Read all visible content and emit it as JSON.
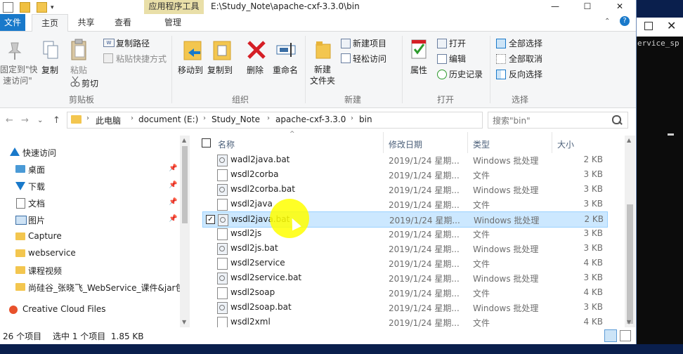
{
  "console": {
    "text": "ervice_sp",
    "close_glyph": "✕",
    "max_glyph": ""
  },
  "titlebar": {
    "context_tab": "应用程序工具",
    "path": "E:\\Study_Note\\apache-cxf-3.3.0\\bin",
    "qa_dropdown": "▾",
    "minimize": "—",
    "maximize": "☐",
    "close": "✕"
  },
  "tabs": {
    "file": "文件",
    "home": "主页",
    "share": "共享",
    "view": "查看",
    "manage": "管理",
    "collapse": "⌃",
    "help": "?"
  },
  "ribbon": {
    "clipboard": {
      "pin_quick": "固定到\"快\n速访问\"",
      "copy": "复制",
      "paste": "粘贴",
      "copy_path": "复制路径",
      "paste_shortcut": "粘贴快捷方式",
      "cut": "剪切",
      "label": "剪贴板"
    },
    "organize": {
      "move_to": "移动到",
      "copy_to": "复制到",
      "delete": "删除",
      "rename": "重命名",
      "label": "组织"
    },
    "new": {
      "new_folder": "新建\n文件夹",
      "new_item": "新建项目",
      "easy_access": "轻松访问",
      "label": "新建"
    },
    "open": {
      "properties": "属性",
      "open": "打开",
      "edit": "编辑",
      "history": "历史记录",
      "label": "打开"
    },
    "select": {
      "select_all": "全部选择",
      "select_none": "全部取消",
      "invert": "反向选择",
      "label": "选择"
    }
  },
  "nav": {
    "back": "←",
    "forward": "→",
    "recent": "⌄",
    "up": "↑",
    "breadcrumb": [
      "此电脑",
      "document (E:)",
      "Study_Note",
      "apache-cxf-3.3.0",
      "bin"
    ],
    "sep": "›",
    "search_placeholder": "搜索\"bin\""
  },
  "navpane": {
    "quick_access": "快速访问",
    "items": [
      {
        "label": "桌面",
        "pinned": true
      },
      {
        "label": "下载",
        "pinned": true
      },
      {
        "label": "文档",
        "pinned": true
      },
      {
        "label": "图片",
        "pinned": true
      },
      {
        "label": "Capture",
        "pinned": false
      },
      {
        "label": "webservice",
        "pinned": false
      },
      {
        "label": "课程视频",
        "pinned": false
      },
      {
        "label": "尚硅谷_张晓飞_WebService_课件&jar包",
        "pinned": false
      }
    ],
    "creative_cloud": "Creative Cloud Files",
    "pin_glyph": "📌"
  },
  "columns": {
    "name": "名称",
    "date": "修改日期",
    "type": "类型",
    "size": "大小",
    "sort_glyph": "^"
  },
  "files": [
    {
      "name": "wadl2java.bat",
      "date": "2019/1/24 星期...",
      "type": "Windows 批处理",
      "size": "2 KB",
      "bat": true
    },
    {
      "name": "wsdl2corba",
      "date": "2019/1/24 星期...",
      "type": "文件",
      "size": "3 KB",
      "bat": false
    },
    {
      "name": "wsdl2corba.bat",
      "date": "2019/1/24 星期...",
      "type": "Windows 批处理",
      "size": "3 KB",
      "bat": true
    },
    {
      "name": "wsdl2java",
      "date": "2019/1/24 星期...",
      "type": "文件",
      "size": "3 KB",
      "bat": false
    },
    {
      "name": "wsdl2java.bat",
      "date": "2019/1/24 星期...",
      "type": "Windows 批处理",
      "size": "2 KB",
      "bat": true,
      "selected": true
    },
    {
      "name": "wsdl2js",
      "date": "2019/1/24 星期...",
      "type": "文件",
      "size": "3 KB",
      "bat": false
    },
    {
      "name": "wsdl2js.bat",
      "date": "2019/1/24 星期...",
      "type": "Windows 批处理",
      "size": "3 KB",
      "bat": true
    },
    {
      "name": "wsdl2service",
      "date": "2019/1/24 星期...",
      "type": "文件",
      "size": "4 KB",
      "bat": false
    },
    {
      "name": "wsdl2service.bat",
      "date": "2019/1/24 星期...",
      "type": "Windows 批处理",
      "size": "3 KB",
      "bat": true
    },
    {
      "name": "wsdl2soap",
      "date": "2019/1/24 星期...",
      "type": "文件",
      "size": "4 KB",
      "bat": false
    },
    {
      "name": "wsdl2soap.bat",
      "date": "2019/1/24 星期...",
      "type": "Windows 批处理",
      "size": "3 KB",
      "bat": true
    },
    {
      "name": "wsdl2xml",
      "date": "2019/1/24 星期...",
      "type": "文件",
      "size": "4 KB",
      "bat": false
    }
  ],
  "status": {
    "count": "26 个项目",
    "selected": "选中 1 个项目  1.85 KB"
  },
  "colors": {
    "accent": "#1979ca",
    "selection": "#cce8ff",
    "highlight": "#ffff00",
    "folder": "#f3c64f"
  }
}
